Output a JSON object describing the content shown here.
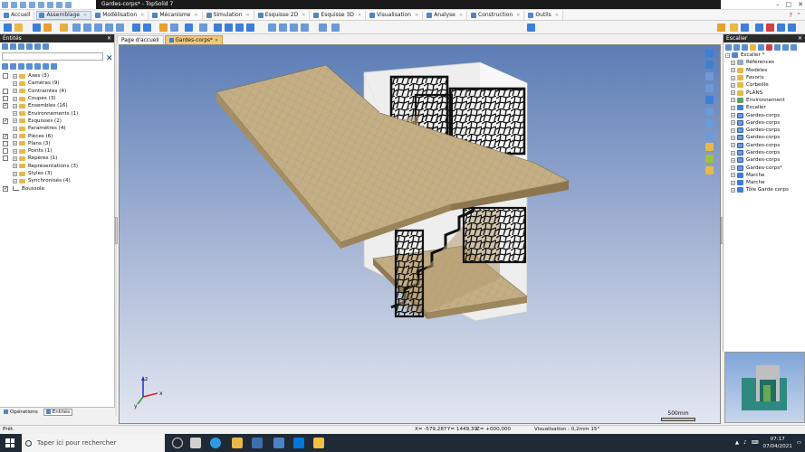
{
  "window": {
    "title": "Gardes-corps* - TopSolid 7",
    "controls": [
      "–",
      "□",
      "✕"
    ]
  },
  "menu": {
    "tabs": [
      {
        "label": "Accueil",
        "active": false
      },
      {
        "label": "Assemblage",
        "active": true
      },
      {
        "label": "Modélisation",
        "active": false
      },
      {
        "label": "Mécanisme",
        "active": false
      },
      {
        "label": "Simulation",
        "active": false
      },
      {
        "label": "Esquisse 2D",
        "active": false
      },
      {
        "label": "Esquisse 3D",
        "active": false
      },
      {
        "label": "Visualisation",
        "active": false
      },
      {
        "label": "Analyse",
        "active": false
      },
      {
        "label": "Construction",
        "active": false
      },
      {
        "label": "Outils",
        "active": false
      }
    ]
  },
  "left_panel": {
    "title": "Entités",
    "close_glyph": "✕",
    "clear_glyph": "✕",
    "items": [
      {
        "label": "Axes (3)",
        "checked": false,
        "icon": "folder"
      },
      {
        "label": "Caméras (9)",
        "checked": null,
        "icon": "folder"
      },
      {
        "label": "Contraintes (4)",
        "checked": false,
        "icon": "folder"
      },
      {
        "label": "Coupes (3)",
        "checked": false,
        "icon": "folder"
      },
      {
        "label": "Ensembles (16)",
        "checked": true,
        "icon": "folder"
      },
      {
        "label": "Environnements (1)",
        "checked": null,
        "icon": "folder"
      },
      {
        "label": "Esquisses (2)",
        "checked": true,
        "icon": "folder"
      },
      {
        "label": "Paramètres (4)",
        "checked": null,
        "icon": "folder"
      },
      {
        "label": "Pièces (6)",
        "checked": true,
        "icon": "folder"
      },
      {
        "label": "Plans (3)",
        "checked": false,
        "icon": "folder"
      },
      {
        "label": "Points (1)",
        "checked": false,
        "icon": "folder"
      },
      {
        "label": "Repères (1)",
        "checked": false,
        "icon": "folder"
      },
      {
        "label": "Représentations (3)",
        "checked": null,
        "icon": "folder"
      },
      {
        "label": "Styles (3)",
        "checked": null,
        "icon": "folder"
      },
      {
        "label": "Synchronisés (4)",
        "checked": null,
        "icon": "folder"
      },
      {
        "label": "Boussole",
        "checked": true,
        "icon": "compass"
      }
    ],
    "footer_tabs": [
      {
        "label": "Opérations",
        "active": false
      },
      {
        "label": "Entités",
        "active": true
      }
    ]
  },
  "doc_tabs": [
    {
      "label": "Page d'accueil",
      "active": false
    },
    {
      "label": "Gardes-corps*",
      "active": true
    }
  ],
  "viewport": {
    "scale_label": "500mm",
    "axis_labels": {
      "x": "x",
      "y": "y",
      "z": "z"
    }
  },
  "right_panel": {
    "title": "Escalier",
    "items": [
      {
        "label": "Escalier *",
        "indent": 0,
        "icon": "stair"
      },
      {
        "label": "Références",
        "indent": 1,
        "icon": "grey"
      },
      {
        "label": "Modèles",
        "indent": 1,
        "icon": "fold"
      },
      {
        "label": "Favoris",
        "indent": 1,
        "icon": "fold"
      },
      {
        "label": "Corbeille",
        "indent": 1,
        "icon": "fold"
      },
      {
        "label": "PLANS",
        "indent": 1,
        "icon": "fold"
      },
      {
        "label": "Environnement",
        "indent": 1,
        "icon": "env"
      },
      {
        "label": "Escalier",
        "indent": 1,
        "icon": "blue"
      },
      {
        "label": "Gardes-corps",
        "indent": 1,
        "icon": "asm"
      },
      {
        "label": "Gardes-corps",
        "indent": 1,
        "icon": "asm"
      },
      {
        "label": "Gardes-corps",
        "indent": 1,
        "icon": "asm"
      },
      {
        "label": "Gardes-corps",
        "indent": 1,
        "icon": "asm"
      },
      {
        "label": "Gardes-corps",
        "indent": 1,
        "icon": "asm"
      },
      {
        "label": "Gardes-corps",
        "indent": 1,
        "icon": "asm"
      },
      {
        "label": "Gardes-corps",
        "indent": 1,
        "icon": "asm"
      },
      {
        "label": "Gardes-corps*",
        "indent": 1,
        "icon": "asm"
      },
      {
        "label": "Marche",
        "indent": 1,
        "icon": "blue"
      },
      {
        "label": "Marche",
        "indent": 1,
        "icon": "blue"
      },
      {
        "label": "Tôle Garde corps",
        "indent": 1,
        "icon": "blue"
      }
    ]
  },
  "status": {
    "left": "Prêt.",
    "x": "X= -579,287",
    "y": "Y= 1449,39",
    "z": "Z= +000,000",
    "visualisation": "Visualisation : 0,2mm 15°"
  },
  "taskbar": {
    "search_placeholder": "Taper ici pour rechercher",
    "time": "07:17",
    "date": "07/04/2021"
  },
  "colors": {
    "accent": "#4f86c6",
    "active_doc_tab": "#f2c87a",
    "wood": "#c2ad84",
    "railing": "#111111",
    "wall": "#ececec"
  }
}
